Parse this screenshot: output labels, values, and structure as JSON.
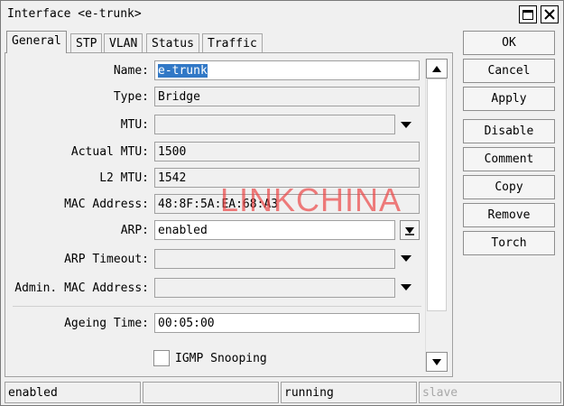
{
  "window": {
    "title": "Interface <e-trunk>"
  },
  "tabs": [
    "General",
    "STP",
    "VLAN",
    "Status",
    "Traffic"
  ],
  "form": {
    "name_label": "Name:",
    "name_value": "e-trunk",
    "type_label": "Type:",
    "type_value": "Bridge",
    "mtu_label": "MTU:",
    "mtu_value": "",
    "actual_mtu_label": "Actual MTU:",
    "actual_mtu_value": "1500",
    "l2mtu_label": "L2 MTU:",
    "l2mtu_value": "1542",
    "mac_label": "MAC Address:",
    "mac_value": "48:8F:5A:EA:68:A3",
    "arp_label": "ARP:",
    "arp_value": "enabled",
    "arp_timeout_label": "ARP Timeout:",
    "arp_timeout_value": "",
    "admin_mac_label": "Admin. MAC Address:",
    "admin_mac_value": "",
    "ageing_label": "Ageing Time:",
    "ageing_value": "00:05:00",
    "igmp_label": "IGMP Snooping",
    "igmp_checked": false
  },
  "buttons": {
    "ok": "OK",
    "cancel": "Cancel",
    "apply": "Apply",
    "disable": "Disable",
    "comment": "Comment",
    "copy": "Copy",
    "remove": "Remove",
    "torch": "Torch"
  },
  "watermark": "LINKCHINA",
  "status": {
    "state": "enabled",
    "blank": "",
    "running": "running",
    "slave": "slave"
  },
  "icons": {
    "maximize": "maximize-icon",
    "close": "close-icon",
    "dropdown": "chevron-down-icon",
    "scroll_up": "scroll-up-icon",
    "scroll_down": "scroll-down-icon"
  },
  "colors": {
    "selection": "#3178c6",
    "watermark": "#eb4646"
  }
}
